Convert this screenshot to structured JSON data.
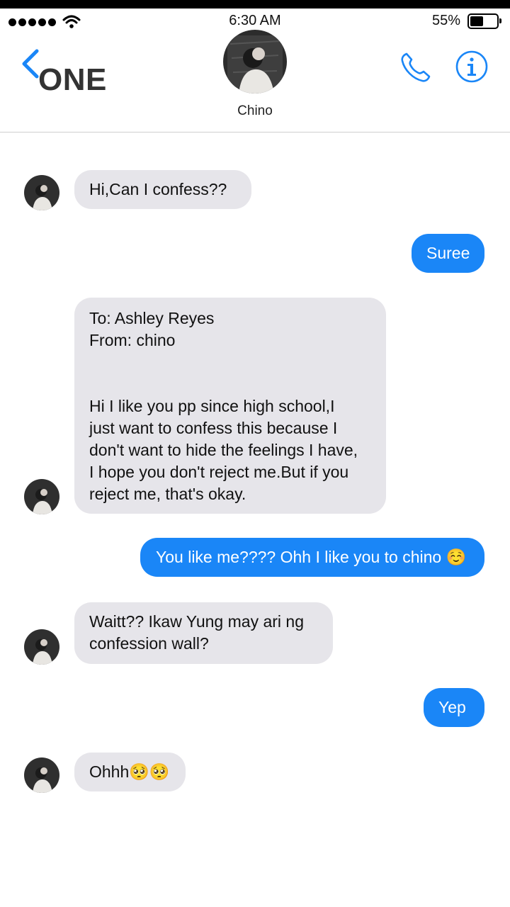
{
  "status_bar": {
    "time": "6:30 AM",
    "battery_percent": "55%",
    "battery_level": 0.55,
    "signal_bars": 5
  },
  "header": {
    "back_label": "ONE",
    "contact_name": "Chino"
  },
  "messages": [
    {
      "direction": "incoming",
      "text": "Hi,Can I confess??"
    },
    {
      "direction": "outgoing",
      "text": "Suree"
    },
    {
      "direction": "incoming",
      "text": "To: Ashley Reyes\nFrom: chino\n\n\nHi I like you pp since high school,I\njust want to confess this because I\ndon't want to hide the feelings I have,\nI hope you don't reject me.But if you\nreject me, that's okay."
    },
    {
      "direction": "outgoing",
      "text": "You like me???? Ohh I like you to chino ☺️"
    },
    {
      "direction": "incoming",
      "text": "Waitt?? Ikaw Yung may ari ng\nconfession wall?"
    },
    {
      "direction": "outgoing",
      "text": "Yep"
    },
    {
      "direction": "incoming",
      "text": "Ohhh🥺🥺"
    }
  ],
  "colors": {
    "outgoing_bubble": "#1a86f7",
    "incoming_bubble": "#e6e5ea",
    "accent": "#1a86f7"
  }
}
